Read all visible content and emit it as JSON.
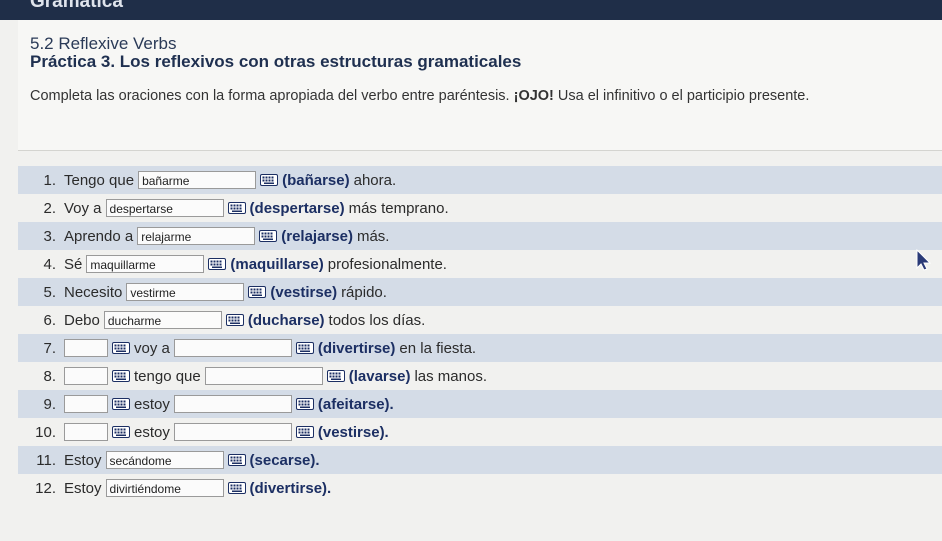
{
  "app": {
    "title": "Gramática"
  },
  "header": {
    "section": "5.2 Reflexive Verbs",
    "practice": "Práctica 3. Los reflexivos con otras estructuras gramaticales",
    "instructions_main": "Completa las oraciones con la forma apropiada del verbo entre paréntesis.",
    "instructions_ojo": "¡OJO!",
    "instructions_tail": "Usa el infinitivo o el participio presente."
  },
  "items": [
    {
      "num": "1.",
      "prefix": "Tengo que",
      "value": "bañarme",
      "verb": "(bañarse)",
      "rest": "ahora."
    },
    {
      "num": "2.",
      "prefix": "Voy a",
      "value": "despertarse",
      "verb": "(despertarse)",
      "rest": "más temprano."
    },
    {
      "num": "3.",
      "prefix": "Aprendo a",
      "value": "relajarme",
      "verb": "(relajarse)",
      "rest": "más."
    },
    {
      "num": "4.",
      "prefix": "Sé",
      "value": "maquillarme",
      "verb": "(maquillarse)",
      "rest": "profesionalmente."
    },
    {
      "num": "5.",
      "prefix": "Necesito",
      "value": "vestirme",
      "verb": "(vestirse)",
      "rest": "rápido."
    },
    {
      "num": "6.",
      "prefix": "Debo",
      "value": "ducharme",
      "verb": "(ducharse)",
      "rest": "todos los días."
    },
    {
      "num": "7.",
      "middle": "voy a",
      "verb": "(divertirse)",
      "rest": "en la fiesta."
    },
    {
      "num": "8.",
      "middle": "tengo que",
      "verb": "(lavarse)",
      "rest": "las manos."
    },
    {
      "num": "9.",
      "middle": "estoy",
      "verb": "(afeitarse).",
      "rest": ""
    },
    {
      "num": "10.",
      "middle": "estoy",
      "verb": "(vestirse).",
      "rest": ""
    },
    {
      "num": "11.",
      "prefix": "Estoy",
      "value": "secándome",
      "verb": "(secarse).",
      "rest": ""
    },
    {
      "num": "12.",
      "prefix": "Estoy",
      "value": "divirtiéndome",
      "verb": "(divertirse).",
      "rest": ""
    }
  ],
  "colors": {
    "accent": "#1c2f63",
    "topbar": "#1f2e48",
    "row_band": "#d4dce7"
  }
}
